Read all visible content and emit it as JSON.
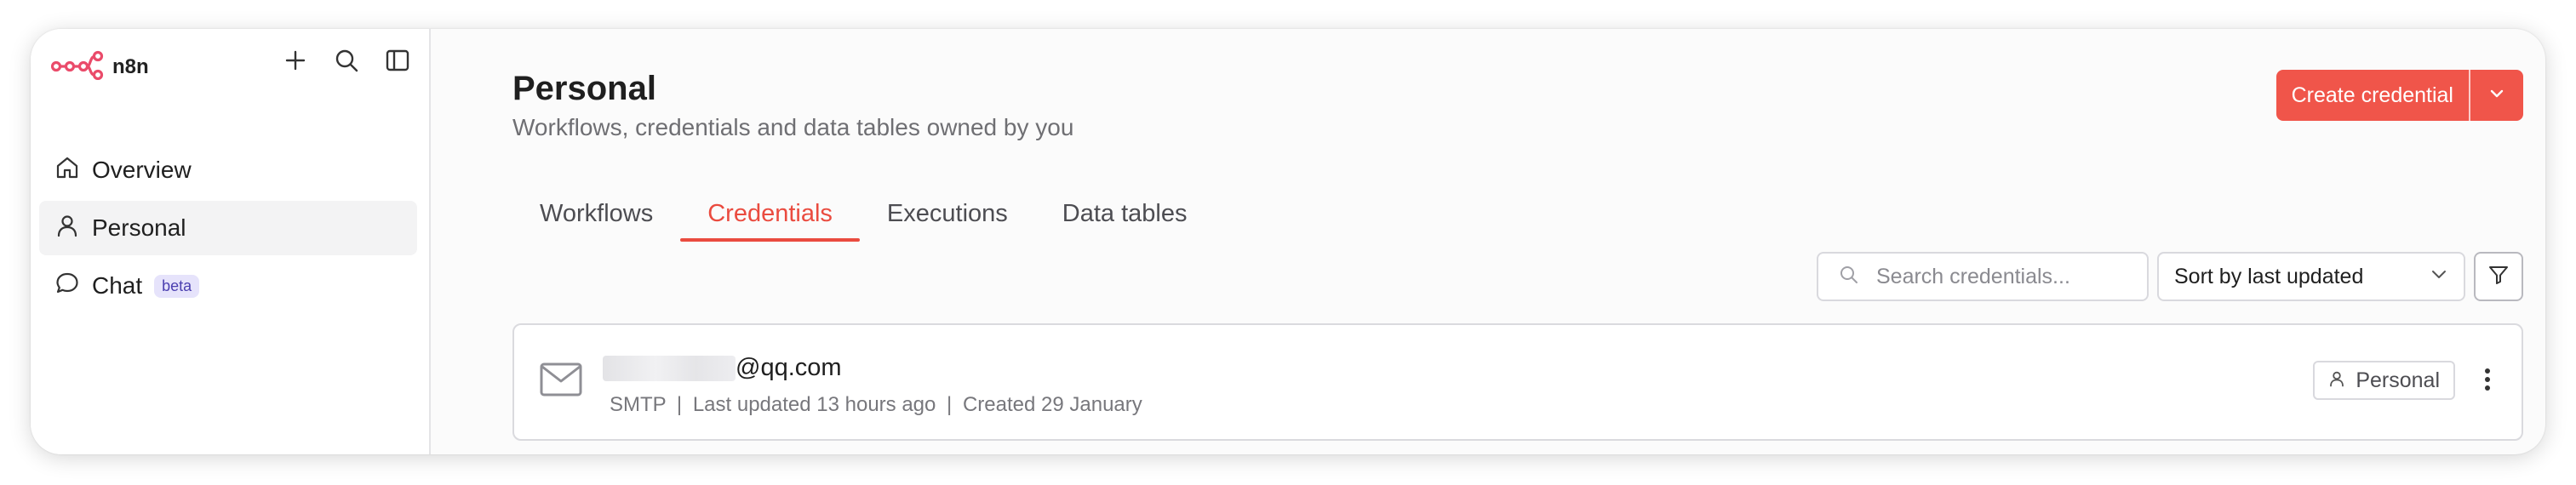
{
  "sidebar": {
    "brand": "n8n",
    "items": [
      {
        "label": "Overview"
      },
      {
        "label": "Personal"
      },
      {
        "label": "Chat",
        "badge": "beta"
      }
    ]
  },
  "header": {
    "title": "Personal",
    "subtitle": "Workflows, credentials and data tables owned by you",
    "create_label": "Create credential"
  },
  "tabs": [
    {
      "label": "Workflows"
    },
    {
      "label": "Credentials",
      "active": true
    },
    {
      "label": "Executions"
    },
    {
      "label": "Data tables"
    }
  ],
  "toolbar": {
    "search_placeholder": "Search credentials...",
    "sort_value": "Sort by last updated"
  },
  "credential": {
    "name_suffix": "@qq.com",
    "type": "SMTP",
    "updated": "Last updated 13 hours ago",
    "created": "Created 29 January",
    "separator": "|",
    "owner": "Personal"
  },
  "colors": {
    "accent": "#ea4b3f",
    "button": "#f0554a",
    "brand": "#ea4b6a"
  },
  "icons": [
    "n8n-logo-icon",
    "plus-icon",
    "search-icon",
    "sidebar-toggle-icon",
    "home-icon",
    "user-icon",
    "chat-icon",
    "chevron-down-icon",
    "filter-icon",
    "mail-icon",
    "more-vertical-icon"
  ]
}
